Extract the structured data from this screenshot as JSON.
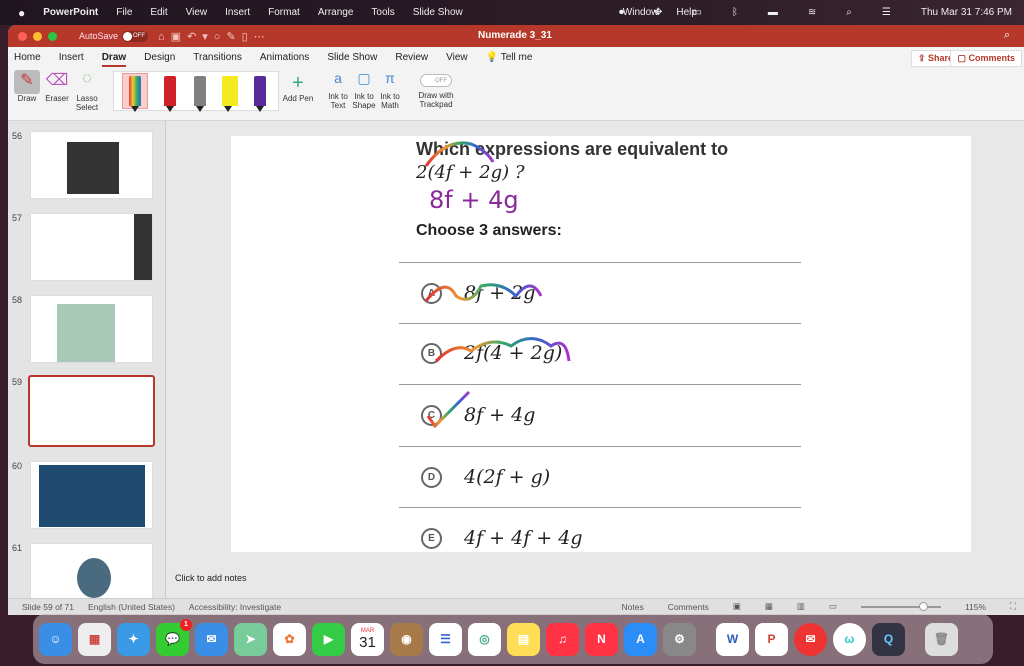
{
  "menubar": {
    "apple": "",
    "app": "PowerPoint",
    "items": [
      "File",
      "Edit",
      "View",
      "Insert",
      "Format",
      "Arrange",
      "Tools",
      "Slide Show",
      "Window",
      "Help"
    ],
    "clock": "Thu Mar 31  7:46 PM"
  },
  "titlebar": {
    "autosave": "AutoSave",
    "autosave_state": "OFF",
    "doc_title": "Numerade 3_31"
  },
  "tabs": [
    "Home",
    "Insert",
    "Draw",
    "Design",
    "Transitions",
    "Animations",
    "Slide Show",
    "Review",
    "View",
    "Tell me"
  ],
  "share": "Share",
  "comments": "Comments",
  "ribbon": {
    "draw": "Draw",
    "eraser": "Eraser",
    "lasso": "Lasso Select",
    "add_pen": "Add Pen",
    "ink_text": "Ink to Text",
    "ink_shape": "Ink to Shape",
    "ink_math": "Ink to Math",
    "trackpad": "Draw with Trackpad",
    "trackpad_state": "OFF",
    "pen_colors": [
      "#3a9a6a",
      "#d0202a",
      "#808080",
      "#f4ea20",
      "#5a2a9a"
    ]
  },
  "thumbnails": [
    {
      "num": "56"
    },
    {
      "num": "57"
    },
    {
      "num": "58"
    },
    {
      "num": "59"
    },
    {
      "num": "60"
    },
    {
      "num": "61"
    }
  ],
  "slide": {
    "question": "Which expressions are equivalent to",
    "expr": "2(4f + 2g) ?",
    "ink_answer": "8f + 4g",
    "choose": "Choose 3 answers:",
    "options": [
      {
        "letter": "A",
        "text": "8f + 2g"
      },
      {
        "letter": "B",
        "text": "2f(4 + 2g)"
      },
      {
        "letter": "C",
        "text": "8f + 4g"
      },
      {
        "letter": "D",
        "text": "4(2f + g)"
      },
      {
        "letter": "E",
        "text": "4f + 4f + 4g"
      }
    ]
  },
  "notes_placeholder": "Click to add notes",
  "status": {
    "slide": "Slide 59 of 71",
    "language": "English (United States)",
    "accessibility": "Accessibility: Investigate",
    "notes": "Notes",
    "comments": "Comments",
    "zoom": "115%"
  },
  "dock": {
    "calendar_month": "MAR",
    "calendar_day": "31",
    "messages_badge": "1"
  }
}
